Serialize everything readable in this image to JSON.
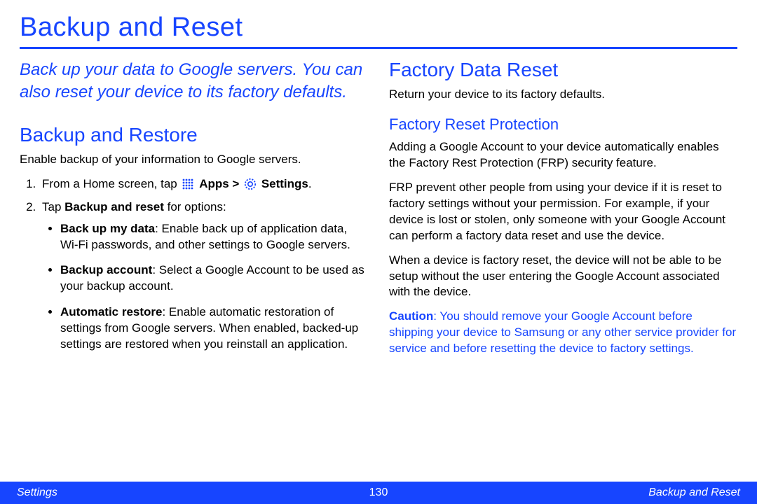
{
  "title": "Backup and Reset",
  "lead": "Back up your data to Google servers. You can also reset your device to its factory defaults.",
  "left": {
    "h2": "Backup and Restore",
    "intro": "Enable backup of your information to Google servers.",
    "step1_prefix": "From a Home screen, tap ",
    "step1_apps_bold": "Apps > ",
    "step1_settings_bold": "Settings",
    "step1_period": ".",
    "step2_prefix": "Tap ",
    "step2_bold": "Backup and reset",
    "step2_suffix": " for options:",
    "bullets": {
      "b1_bold": "Back up my data",
      "b1_rest": ": Enable back up of application data, Wi-Fi passwords, and other settings to Google servers.",
      "b2_bold": "Backup account",
      "b2_rest": ": Select a Google Account to be used as your backup account.",
      "b3_bold": "Automatic restore",
      "b3_rest": ": Enable automatic restoration of settings from Google servers. When enabled, backed-up settings are restored when you reinstall an application."
    }
  },
  "right": {
    "h2": "Factory Data Reset",
    "intro": "Return your device to its factory defaults.",
    "h3": "Factory Reset Protection",
    "p1": "Adding a Google Account to your device automatically enables the Factory Rest Protection (FRP) security feature.",
    "p2": "FRP prevent other people from using your device if it is reset to factory settings without your permission.  For example, if your device is lost or stolen, only someone with your Google Account can perform a factory data reset and use the device.",
    "p3": "When a device is factory reset, the device will not be able to be setup without the user entering the Google Account associated with the device.",
    "caution_label": "Caution",
    "caution_body": ": You should remove your Google Account before shipping your device to Samsung or any other service provider for service and before resetting the device to factory settings."
  },
  "footer": {
    "left": "Settings",
    "center": "130",
    "right": "Backup and Reset"
  }
}
